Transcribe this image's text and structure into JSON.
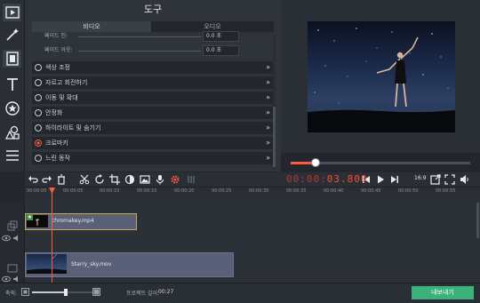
{
  "panel": {
    "title": "도구",
    "tabs": [
      "비디오",
      "오디오"
    ],
    "fade_in": {
      "label": "페이드 인:",
      "value": "0.0 초"
    },
    "fade_out": {
      "label": "페이드 아웃:",
      "value": "0.0 초"
    },
    "effects": [
      {
        "label": "색상 조정"
      },
      {
        "label": "자르고 회전하기"
      },
      {
        "label": "이동 및 확대"
      },
      {
        "label": "안정화"
      },
      {
        "label": "하이라이트 및 숨기기"
      },
      {
        "label": "크로마키"
      },
      {
        "label": "느린 동작"
      }
    ]
  },
  "left_toolbar": [
    "film-import-icon",
    "magic-wand-icon",
    "filmstrip-icon",
    "text-icon",
    "star-badge-icon",
    "shapes-icon",
    "list-icon"
  ],
  "playback": {
    "timecode_main": "00:00",
    "timecode_ms": "03.800",
    "aspect_ratio": "16:9",
    "seek_progress": 0.12
  },
  "ruler": {
    "ticks": [
      "00:00:00",
      "00:00:05",
      "00:00:10",
      "00:00:15",
      "00:00:20",
      "00:00:25",
      "00:00:30",
      "00:00:35",
      "00:00:40",
      "00:00:45",
      "00:00:50",
      "00:00:55"
    ]
  },
  "timeline": {
    "clip1": {
      "name": "chromakey.mp4",
      "badge": "★"
    },
    "clip2": {
      "name": "Starry_sky.mov"
    }
  },
  "bottom": {
    "zoom_label": "축척:",
    "duration_label": "프로젝트 길이:",
    "duration_value": "00:27",
    "export_label": "내보내기"
  },
  "colors": {
    "accent": "#ff5a42",
    "export": "#3bb27a",
    "clip": "#5a6077",
    "selected_border": "#c9a84a"
  }
}
